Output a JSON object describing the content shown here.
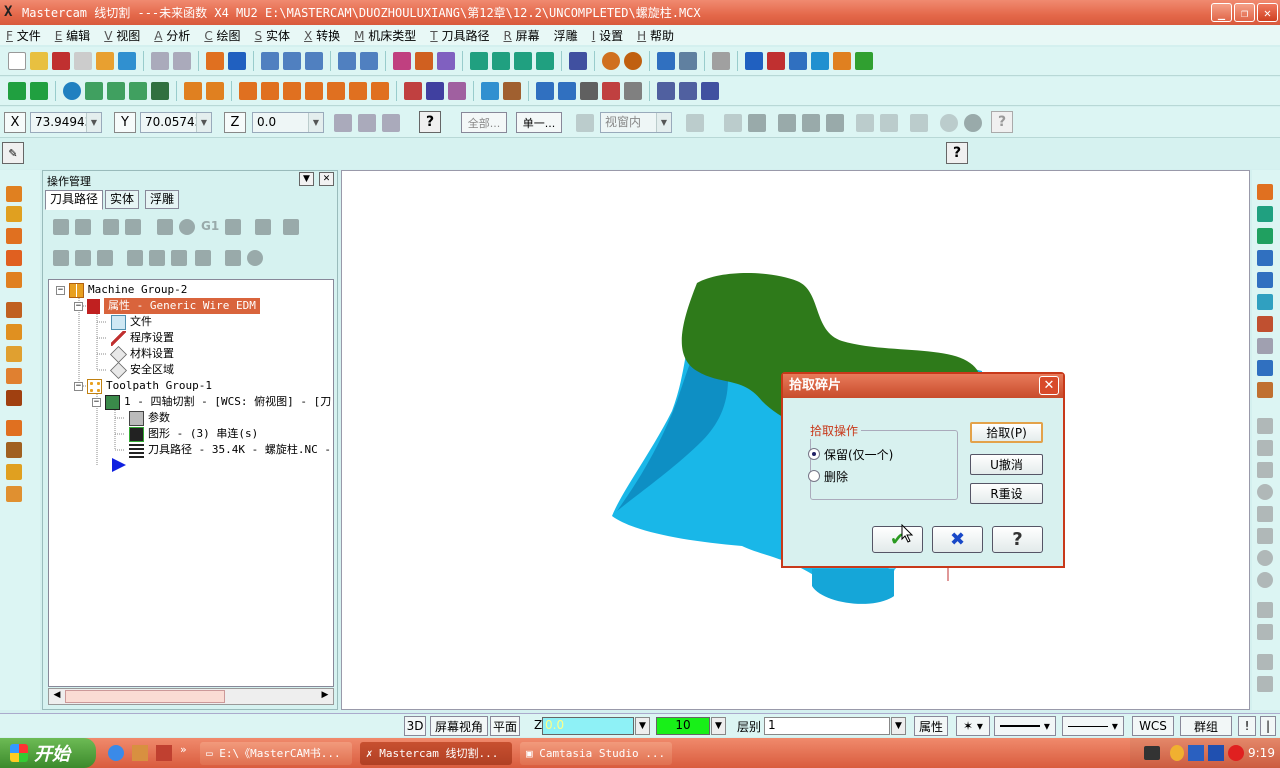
{
  "window": {
    "title": "Mastercam 线切割 ---未来函数 X4 MU2  E:\\MASTERCAM\\DUOZHOULUXIANG\\第12章\\12.2\\UNCOMPLETED\\螺旋柱.MCX",
    "app_icon": "X"
  },
  "menu": [
    {
      "key": "F",
      "label": "文件"
    },
    {
      "key": "E",
      "label": "编辑"
    },
    {
      "key": "V",
      "label": "视图"
    },
    {
      "key": "A",
      "label": "分析"
    },
    {
      "key": "C",
      "label": "绘图"
    },
    {
      "key": "S",
      "label": "实体"
    },
    {
      "key": "X",
      "label": "转换"
    },
    {
      "key": "M",
      "label": "机床类型"
    },
    {
      "key": "T",
      "label": "刀具路径"
    },
    {
      "key": "R",
      "label": "屏幕"
    },
    {
      "key": "",
      "label": "浮雕"
    },
    {
      "key": "I",
      "label": "设置"
    },
    {
      "key": "H",
      "label": "帮助"
    }
  ],
  "coords": {
    "x_label": "X",
    "x_value": "73.94943",
    "y_label": "Y",
    "y_value": "70.05743",
    "z_label": "Z",
    "z_value": "0.0",
    "all_label": "全部...",
    "single_label": "单一...",
    "window_sel": "视窗内"
  },
  "ops": {
    "title": "操作管理",
    "tabs": [
      "刀具路径",
      "实体",
      "浮雕"
    ],
    "icon_text_g1": "G1",
    "tree": {
      "machine_group": "Machine Group-2",
      "properties": "属性 - Generic Wire EDM",
      "files": "文件",
      "program": "程序设置",
      "material": "材料设置",
      "safety": "安全区域",
      "toolpath_group": "Toolpath Group-1",
      "op1": "1 - 四轴切割 - [WCS: 俯视图] - [刀",
      "params": "参数",
      "geometry": "图形 - (3) 串连(s)",
      "toolpath": "刀具路径 - 35.4K - 螺旋柱.NC -"
    }
  },
  "dialog": {
    "title": "拾取碎片",
    "group_label": "拾取操作",
    "option_keep": "保留(仅一个)",
    "option_delete": "删除",
    "btn_pick": "拾取(P)",
    "btn_undo": "U撤消",
    "btn_reset": "R重设"
  },
  "status": {
    "btn_3d": "3D",
    "btn_screen_view": "屏幕视角",
    "btn_plane": "平面",
    "z_label": "Z",
    "z_value": "0.0",
    "color_value": "10",
    "level_label": "层别",
    "level_value": "1",
    "attr_label": "属性",
    "wcs_label": "WCS",
    "group_label": "群组"
  },
  "taskbar": {
    "start": "开始",
    "tasks": [
      "E:\\《MasterCAM书...",
      "Mastercam 线切割...",
      "Camtasia Studio ..."
    ],
    "clock": "9:19"
  },
  "colors": {
    "title_bar": "#e4684a",
    "solid_top": "#2e7a1a",
    "solid_side": "#19b7e8",
    "dialog_accent": "#c8391a"
  }
}
